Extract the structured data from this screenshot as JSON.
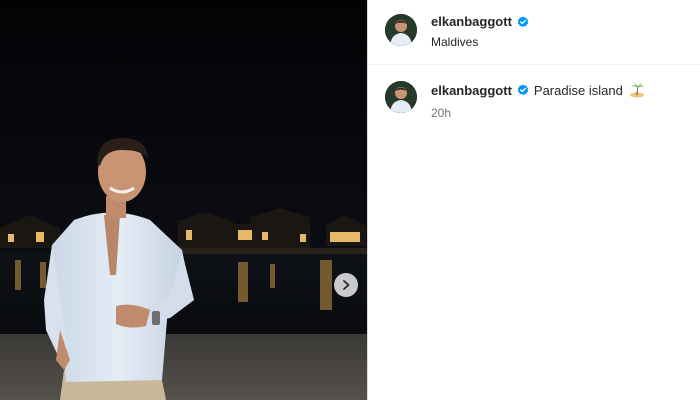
{
  "post": {
    "username": "elkanbaggott",
    "location": "Maldives",
    "caption_text": "Paradise island",
    "caption_emoji": "desert-island-icon",
    "timestamp": "20h"
  },
  "icons": {
    "verified": "verified-badge-icon",
    "next": "chevron-right-icon"
  },
  "colors": {
    "verified_blue": "#0095f6",
    "text_primary": "#262626",
    "text_secondary": "#737373"
  }
}
